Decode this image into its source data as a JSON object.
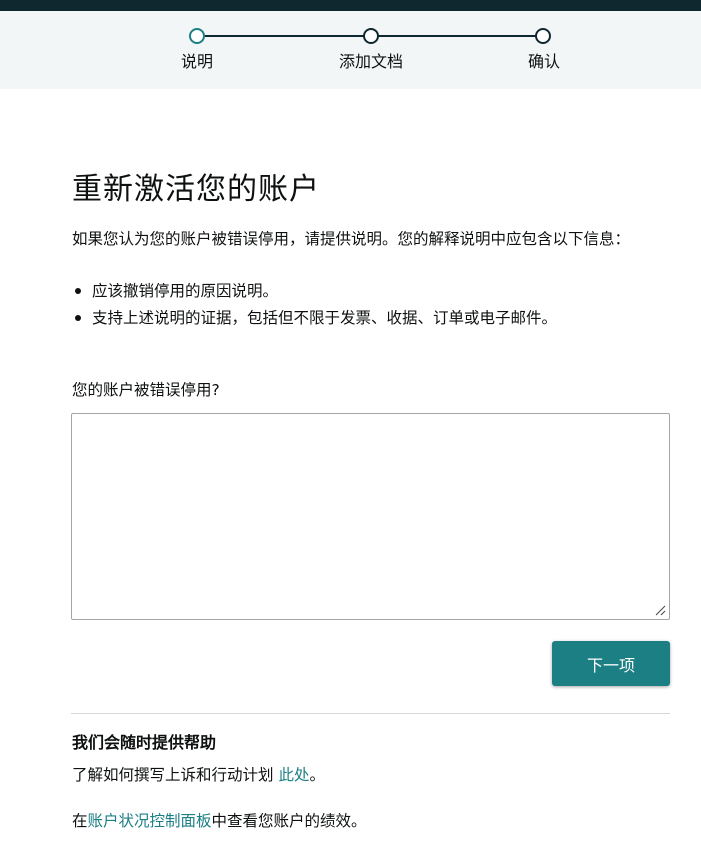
{
  "stepper": {
    "steps": [
      {
        "label": "说明",
        "state": "current"
      },
      {
        "label": "添加文档",
        "state": "pending"
      },
      {
        "label": "确认",
        "state": "pending"
      }
    ],
    "accent_color": "#1b7f84",
    "line_color": "#0f2830"
  },
  "main": {
    "title": "重新激活您的账户",
    "intro": "如果您认为您的账户被错误停用，请提供说明。您的解释说明中应包含以下信息：",
    "bullets": [
      "应该撤销停用的原因说明。",
      "支持上述说明的证据，包括但不限于发票、收据、订单或电子邮件。"
    ],
    "field_label": "您的账户被错误停用?",
    "textarea_value": "",
    "next_button": "下一项"
  },
  "help": {
    "title": "我们会随时提供帮助",
    "line1_prefix": "了解如何撰写上诉和行动计划 ",
    "line1_link": "此处",
    "line1_suffix": "。",
    "line2_prefix": "在",
    "line2_link": "账户状况控制面板",
    "line2_suffix": "中查看您账户的绩效。"
  },
  "colors": {
    "button_bg": "#1b7f84",
    "link": "#1b7f84",
    "header_bar": "#0f2830"
  }
}
